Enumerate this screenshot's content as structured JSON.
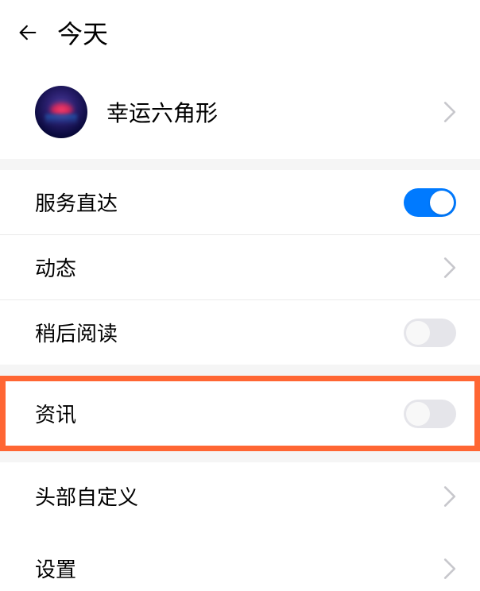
{
  "header": {
    "title": "今天"
  },
  "profile": {
    "name": "幸运六角形"
  },
  "rows": {
    "service_direct": {
      "label": "服务直达",
      "on": true
    },
    "dynamic": {
      "label": "动态"
    },
    "read_later": {
      "label": "稍后阅读",
      "on": false
    },
    "news": {
      "label": "资讯",
      "on": false
    },
    "header_custom": {
      "label": "头部自定义"
    },
    "settings": {
      "label": "设置"
    }
  },
  "colors": {
    "accent": "#007aff",
    "highlight": "#ff6633"
  }
}
